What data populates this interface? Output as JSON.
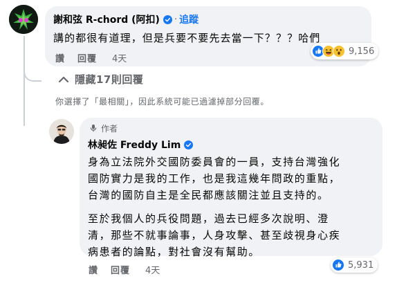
{
  "comment": {
    "author": "謝和弦 R-chord (阿扣)",
    "separator": "·",
    "follow_label": "追蹤",
    "text": "講的都很有道理，但是兵要不要先去當一下？？？哈們",
    "actions": {
      "like": "讚",
      "reply": "回覆",
      "time": "4天"
    },
    "reaction_count": "9,156",
    "reactions": [
      "like",
      "haha",
      "wow"
    ]
  },
  "hidden_replies": {
    "label": "隱藏17則回覆",
    "icon": "hide-arrow-icon"
  },
  "filter_note": "你選擇了「最相關」，因此系統可能已過濾掉部分回覆。",
  "reply": {
    "badge": "作者",
    "author": "林昶佐 Freddy Lim",
    "paragraph1": [
      "身為立法院外交國防委員會的一員，支持台灣強化",
      "國防實力是我的工作，也是我這幾年問政的重點，",
      "台灣的國防自主是全民都應該關注並且支持的。"
    ],
    "paragraph2": [
      "至於我個人的兵役問題，過去已經多次說明、澄",
      "清，那些不就事論事，人身攻擊、甚至歧視身心疾",
      "病患者的論點，對社會沒有幫助。"
    ],
    "actions": {
      "like": "讚",
      "reply": "回覆",
      "time": "4天"
    },
    "reaction_count": "5,931",
    "reactions": [
      "like"
    ]
  },
  "colors": {
    "bubble": "#f0f2f5",
    "link": "#1877f2",
    "muted": "#65676b",
    "verified": "#1877f2"
  }
}
